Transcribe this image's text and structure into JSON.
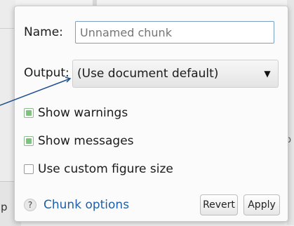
{
  "chunk_options_popup": {
    "name": {
      "label": "Name:",
      "placeholder": "Unnamed chunk"
    },
    "output": {
      "label": "Output:",
      "selected": "(Use document default)"
    },
    "checkboxes": [
      {
        "label": "Show warnings",
        "checked": true
      },
      {
        "label": "Show messages",
        "checked": true
      },
      {
        "label": "Use custom figure size",
        "checked": false
      }
    ],
    "help": {
      "icon_text": "?",
      "link_text": "Chunk options"
    },
    "buttons": {
      "revert": "Revert",
      "apply": "Apply"
    }
  },
  "background": {
    "left_fragment_text": "p",
    "right_fragment_text": "p"
  },
  "colors": {
    "link": "#1f5fa8",
    "input_border": "#7aa0c8",
    "pointer_line": "#1e4f8f"
  }
}
